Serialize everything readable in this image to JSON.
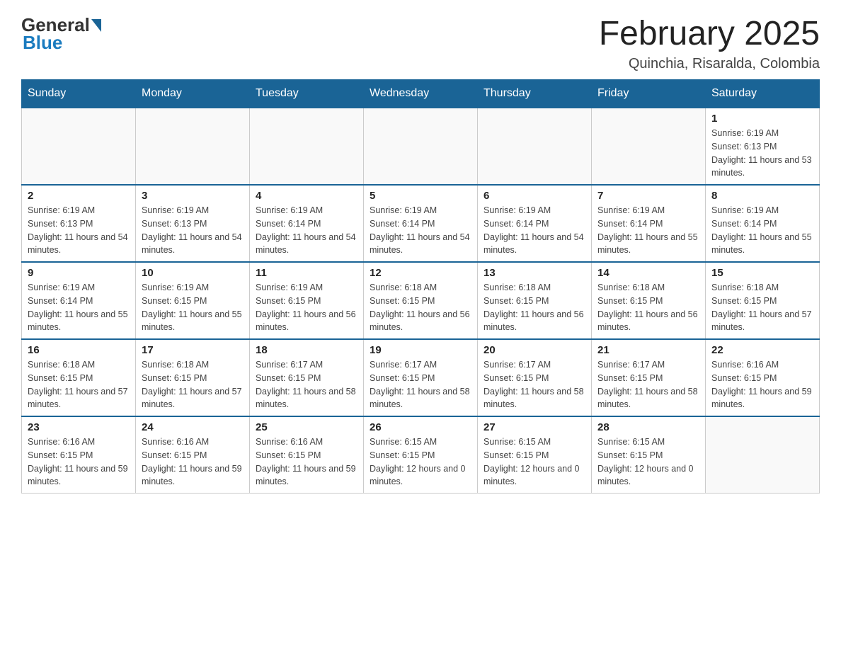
{
  "header": {
    "logo_general": "General",
    "logo_blue": "Blue",
    "month_title": "February 2025",
    "location": "Quinchia, Risaralda, Colombia"
  },
  "days_of_week": [
    "Sunday",
    "Monday",
    "Tuesday",
    "Wednesday",
    "Thursday",
    "Friday",
    "Saturday"
  ],
  "weeks": [
    [
      {
        "day": "",
        "info": ""
      },
      {
        "day": "",
        "info": ""
      },
      {
        "day": "",
        "info": ""
      },
      {
        "day": "",
        "info": ""
      },
      {
        "day": "",
        "info": ""
      },
      {
        "day": "",
        "info": ""
      },
      {
        "day": "1",
        "info": "Sunrise: 6:19 AM\nSunset: 6:13 PM\nDaylight: 11 hours and 53 minutes."
      }
    ],
    [
      {
        "day": "2",
        "info": "Sunrise: 6:19 AM\nSunset: 6:13 PM\nDaylight: 11 hours and 54 minutes."
      },
      {
        "day": "3",
        "info": "Sunrise: 6:19 AM\nSunset: 6:13 PM\nDaylight: 11 hours and 54 minutes."
      },
      {
        "day": "4",
        "info": "Sunrise: 6:19 AM\nSunset: 6:14 PM\nDaylight: 11 hours and 54 minutes."
      },
      {
        "day": "5",
        "info": "Sunrise: 6:19 AM\nSunset: 6:14 PM\nDaylight: 11 hours and 54 minutes."
      },
      {
        "day": "6",
        "info": "Sunrise: 6:19 AM\nSunset: 6:14 PM\nDaylight: 11 hours and 54 minutes."
      },
      {
        "day": "7",
        "info": "Sunrise: 6:19 AM\nSunset: 6:14 PM\nDaylight: 11 hours and 55 minutes."
      },
      {
        "day": "8",
        "info": "Sunrise: 6:19 AM\nSunset: 6:14 PM\nDaylight: 11 hours and 55 minutes."
      }
    ],
    [
      {
        "day": "9",
        "info": "Sunrise: 6:19 AM\nSunset: 6:14 PM\nDaylight: 11 hours and 55 minutes."
      },
      {
        "day": "10",
        "info": "Sunrise: 6:19 AM\nSunset: 6:15 PM\nDaylight: 11 hours and 55 minutes."
      },
      {
        "day": "11",
        "info": "Sunrise: 6:19 AM\nSunset: 6:15 PM\nDaylight: 11 hours and 56 minutes."
      },
      {
        "day": "12",
        "info": "Sunrise: 6:18 AM\nSunset: 6:15 PM\nDaylight: 11 hours and 56 minutes."
      },
      {
        "day": "13",
        "info": "Sunrise: 6:18 AM\nSunset: 6:15 PM\nDaylight: 11 hours and 56 minutes."
      },
      {
        "day": "14",
        "info": "Sunrise: 6:18 AM\nSunset: 6:15 PM\nDaylight: 11 hours and 56 minutes."
      },
      {
        "day": "15",
        "info": "Sunrise: 6:18 AM\nSunset: 6:15 PM\nDaylight: 11 hours and 57 minutes."
      }
    ],
    [
      {
        "day": "16",
        "info": "Sunrise: 6:18 AM\nSunset: 6:15 PM\nDaylight: 11 hours and 57 minutes."
      },
      {
        "day": "17",
        "info": "Sunrise: 6:18 AM\nSunset: 6:15 PM\nDaylight: 11 hours and 57 minutes."
      },
      {
        "day": "18",
        "info": "Sunrise: 6:17 AM\nSunset: 6:15 PM\nDaylight: 11 hours and 58 minutes."
      },
      {
        "day": "19",
        "info": "Sunrise: 6:17 AM\nSunset: 6:15 PM\nDaylight: 11 hours and 58 minutes."
      },
      {
        "day": "20",
        "info": "Sunrise: 6:17 AM\nSunset: 6:15 PM\nDaylight: 11 hours and 58 minutes."
      },
      {
        "day": "21",
        "info": "Sunrise: 6:17 AM\nSunset: 6:15 PM\nDaylight: 11 hours and 58 minutes."
      },
      {
        "day": "22",
        "info": "Sunrise: 6:16 AM\nSunset: 6:15 PM\nDaylight: 11 hours and 59 minutes."
      }
    ],
    [
      {
        "day": "23",
        "info": "Sunrise: 6:16 AM\nSunset: 6:15 PM\nDaylight: 11 hours and 59 minutes."
      },
      {
        "day": "24",
        "info": "Sunrise: 6:16 AM\nSunset: 6:15 PM\nDaylight: 11 hours and 59 minutes."
      },
      {
        "day": "25",
        "info": "Sunrise: 6:16 AM\nSunset: 6:15 PM\nDaylight: 11 hours and 59 minutes."
      },
      {
        "day": "26",
        "info": "Sunrise: 6:15 AM\nSunset: 6:15 PM\nDaylight: 12 hours and 0 minutes."
      },
      {
        "day": "27",
        "info": "Sunrise: 6:15 AM\nSunset: 6:15 PM\nDaylight: 12 hours and 0 minutes."
      },
      {
        "day": "28",
        "info": "Sunrise: 6:15 AM\nSunset: 6:15 PM\nDaylight: 12 hours and 0 minutes."
      },
      {
        "day": "",
        "info": ""
      }
    ]
  ]
}
